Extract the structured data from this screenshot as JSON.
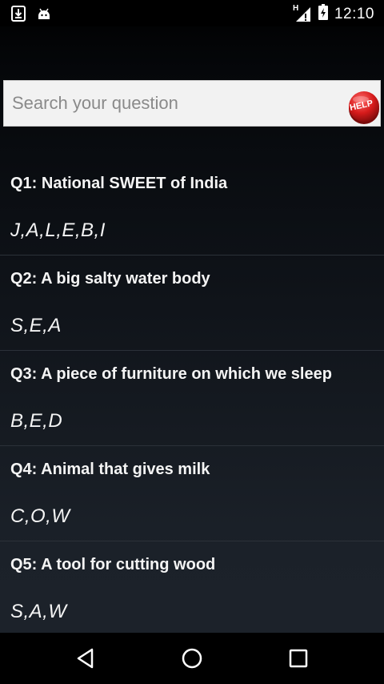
{
  "status_bar": {
    "time": "12:10",
    "left_icons": [
      "download-icon",
      "android-debug-icon"
    ],
    "right_icons": [
      "signal-icon",
      "battery-icon"
    ],
    "network_type": "H"
  },
  "search": {
    "placeholder": "Search your question",
    "help_button_label": "HELP",
    "help_button_color": "#d61b1b"
  },
  "questions": [
    {
      "question": "Q1: National SWEET of India",
      "answer": "J,A,L,E,B,I"
    },
    {
      "question": "Q2: A big salty water body",
      "answer": "S,E,A"
    },
    {
      "question": "Q3: A piece of furniture on which we sleep",
      "answer": "B,E,D"
    },
    {
      "question": "Q4: Animal that gives milk",
      "answer": "C,O,W"
    },
    {
      "question": "Q5: A tool for cutting wood",
      "answer": "S,A,W"
    }
  ],
  "nav_bar": {
    "buttons": [
      "back-icon",
      "home-icon",
      "recents-icon"
    ]
  }
}
